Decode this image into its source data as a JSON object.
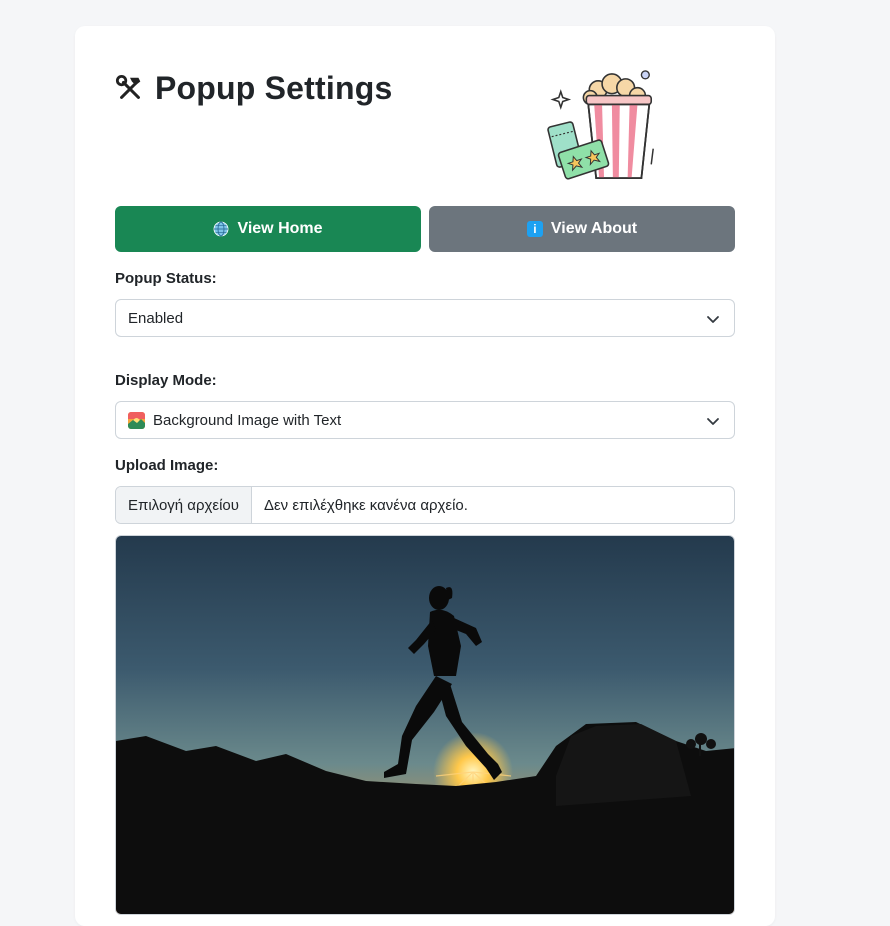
{
  "header": {
    "title": "Popup Settings",
    "title_icon": "hammer-and-wrench-icon",
    "illustration": "popcorn-and-tickets-illustration"
  },
  "buttons": {
    "home": {
      "label": "View Home",
      "icon": "globe-icon",
      "color": "#198754"
    },
    "about": {
      "label": "View About",
      "icon": "info-icon",
      "color": "#6c757d"
    }
  },
  "popup_status": {
    "label": "Popup Status:",
    "selected": "Enabled"
  },
  "display_mode": {
    "label": "Display Mode:",
    "selected": "Background Image with Text",
    "icon": "sunrise-image-icon"
  },
  "upload": {
    "label": "Upload Image:",
    "button_label": "Επιλογή αρχείου",
    "status_text": "Δεν επιλέχθηκε κανένα αρχείο."
  },
  "preview": {
    "description_icon": "runner-silhouette-sunset-image"
  },
  "colors": {
    "page_bg": "#f5f6f8",
    "card_bg": "#ffffff",
    "border": "#ced4da"
  }
}
